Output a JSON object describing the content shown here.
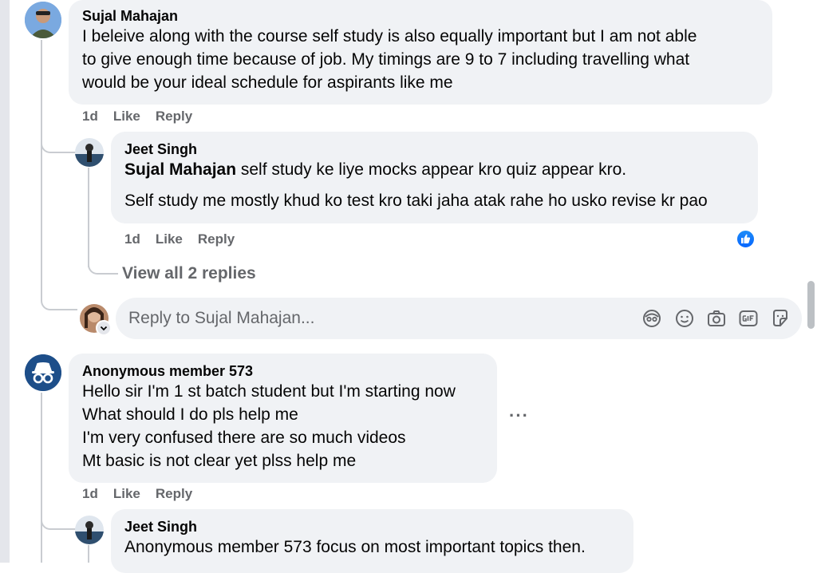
{
  "comments": [
    {
      "author": "Sujal Mahajan",
      "lines": [
        "I beleive along with the course self study is also equally important but I am not able",
        "to give enough time because of job. My timings are 9 to 7 including travelling what",
        "would be your ideal schedule for aspirants like me"
      ],
      "time": "1d",
      "like": "Like",
      "reply": "Reply",
      "replies": [
        {
          "author": "Jeet Singh",
          "mention": "Sujal Mahajan",
          "line1": " self study ke liye mocks appear kro quiz appear kro.",
          "line2": "Self study me mostly khud ko test kro taki jaha atak rahe ho usko revise kr pao",
          "time": "1d",
          "like": "Like",
          "reply": "Reply"
        }
      ],
      "view_replies": "View all 2 replies",
      "reply_placeholder": "Reply to Sujal Mahajan..."
    },
    {
      "author": "Anonymous member 573",
      "lines": [
        "Hello sir I'm 1 st batch student but I'm starting now",
        "What should I do pls help me",
        "I'm very confused there are so much videos",
        "Mt basic is not clear yet plss help me"
      ],
      "time": "1d",
      "like": "Like",
      "reply": "Reply",
      "more": "···",
      "replies": [
        {
          "author": "Jeet Singh",
          "line1": "Anonymous member 573 focus on most important topics then."
        }
      ]
    }
  ],
  "composer_icons": [
    "avatar-sticker-icon",
    "emoji-icon",
    "camera-icon",
    "gif-icon",
    "sticker-icon"
  ],
  "colors": {
    "bubble": "#f0f2f5",
    "meta": "#65676b",
    "like_blue": "#0866ff"
  }
}
